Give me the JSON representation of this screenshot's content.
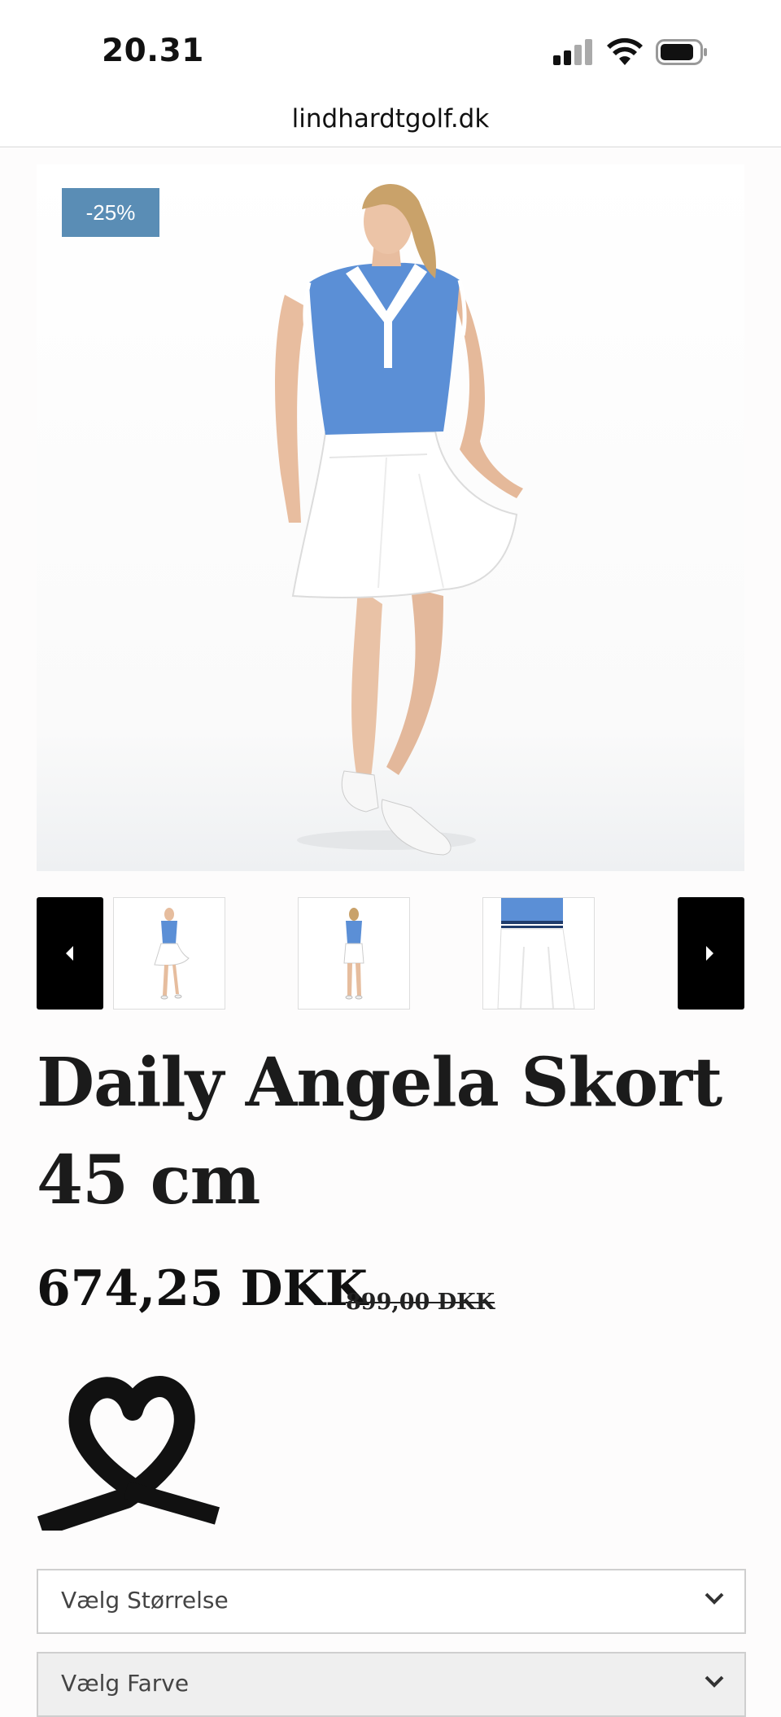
{
  "status_bar": {
    "time": "20.31"
  },
  "browser": {
    "url": "lindhardtgolf.dk"
  },
  "product": {
    "discount_badge": "-25%",
    "title": "Daily Angela Skort 45 cm",
    "price": "674,25 DKK",
    "old_price": "899,00 DKK"
  },
  "gallery": {
    "thumbnails": [
      "front view",
      "back view",
      "detail view"
    ]
  },
  "options": {
    "size_placeholder": "Vælg Størrelse",
    "color_placeholder": "Vælg Farve"
  },
  "colors": {
    "badge": "#5a8db5",
    "shirt": "#5b8fd6"
  }
}
